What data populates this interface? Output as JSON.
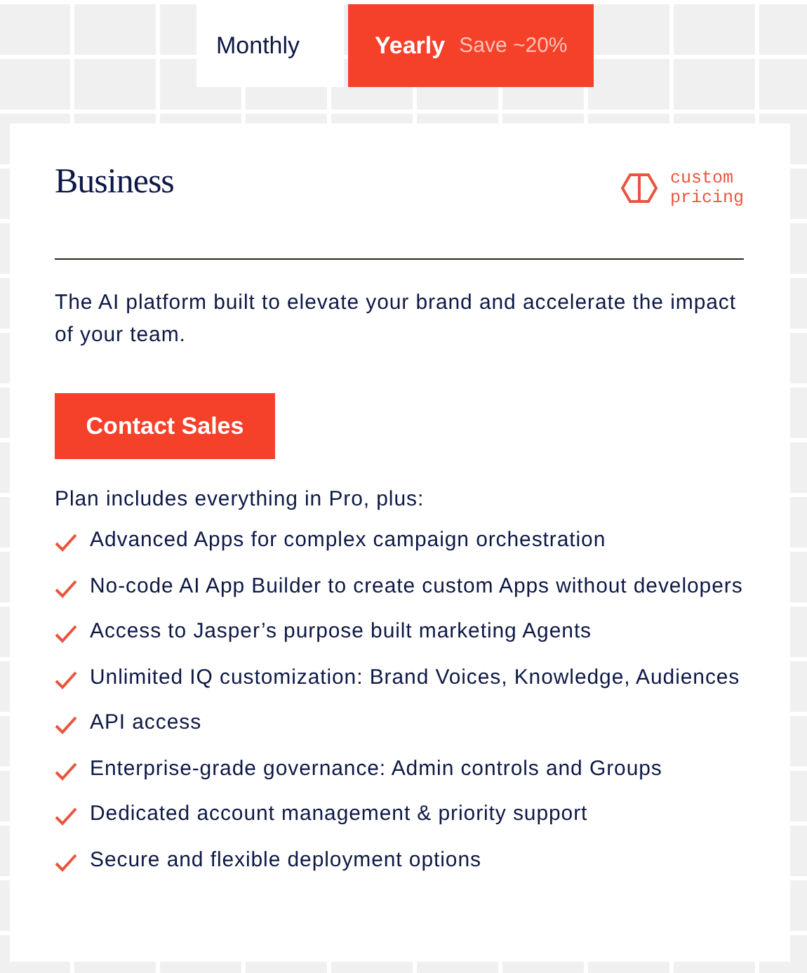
{
  "billing_tabs": [
    {
      "label": "Monthly",
      "selected": false
    },
    {
      "label": "Yearly",
      "badge": "Save ~20%",
      "selected": true
    }
  ],
  "plan": {
    "name": "Business",
    "pricing_label": "custom\npricing",
    "description": "The AI platform built to elevate your brand and accelerate the impact of your team.",
    "cta": "Contact Sales",
    "features_intro": "Plan includes everything in Pro, plus:",
    "features": [
      "Advanced Apps for complex campaign orchestration",
      "No-code AI App Builder to create custom Apps without developers",
      "Access to Jasper’s purpose built marketing Agents",
      "Unlimited IQ customization: Brand Voices, Knowledge, Audiences",
      "API access",
      "Enterprise-grade governance: Admin controls and Groups",
      "Dedicated account management & priority support",
      "Secure and flexible deployment options"
    ]
  }
}
